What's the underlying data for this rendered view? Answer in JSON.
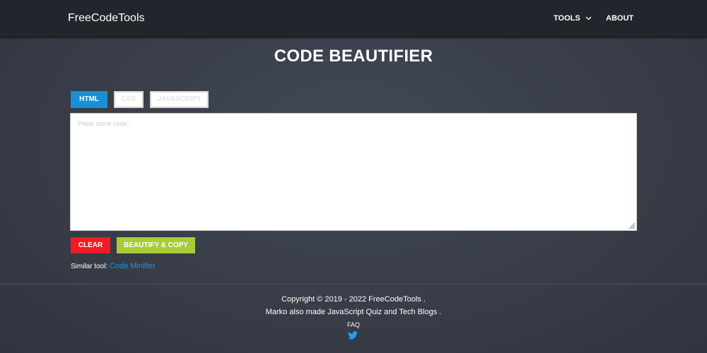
{
  "header": {
    "brand": "FreeCodeTools",
    "nav": [
      {
        "label": "TOOLS",
        "icon": "chevron-down-icon"
      },
      {
        "label": "ABOUT"
      }
    ]
  },
  "main": {
    "title": "CODE BEAUTIFIER",
    "tabs": [
      {
        "label": "HTML",
        "active": true
      },
      {
        "label": "CSS",
        "active": false
      },
      {
        "label": "JAVASCRIPT",
        "active": false
      }
    ],
    "editor": {
      "placeholder": "Paste some code...",
      "value": ""
    },
    "buttons": {
      "clear": "CLEAR",
      "beautify": "BEAUTIFY & COPY"
    },
    "similar": {
      "prefix": "Similar tool:",
      "link": "Code Minifier"
    }
  },
  "footer": {
    "copyright": "Copyright © 2019 - 2022 FreeCodeTools .",
    "credit": "Marko also made JavaScript Quiz and Tech Blogs .",
    "faq": "FAQ",
    "social_icon": "twitter-icon"
  },
  "colors": {
    "accent_blue": "#1a8fd6",
    "clear_red": "#f21b23",
    "beautify_green": "#a9cc34",
    "navbar": "#22252b",
    "background": "#3a3f4b"
  }
}
